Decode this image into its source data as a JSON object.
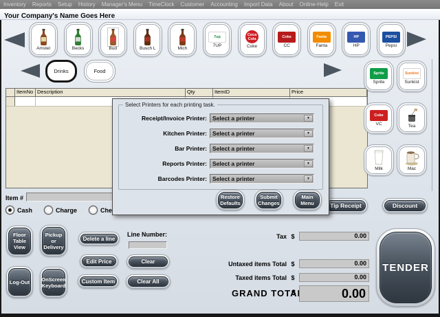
{
  "menu": {
    "items": [
      "Inventory",
      "Reports",
      "Setup",
      "History",
      "Manager's Menu",
      "TimeClock",
      "Customer",
      "Accounting",
      "Import Data",
      "About",
      "Online-Help",
      "Exit"
    ]
  },
  "header": {
    "company_name": "Your Company's Name Goes Here"
  },
  "products": {
    "top": [
      {
        "label": "Amstel",
        "icon": "bottle",
        "color": "#8a4a1f",
        "accent": "#e6d8a8"
      },
      {
        "label": "Becks",
        "icon": "bottle",
        "color": "#2e7d32",
        "accent": "#cfd8cf"
      },
      {
        "label": "Bud",
        "icon": "bottle",
        "color": "#9a5b2a",
        "accent": "#d8433f",
        "focus": true
      },
      {
        "label": "Busch L",
        "icon": "bottle",
        "color": "#5f2f10",
        "accent": "#a93226"
      },
      {
        "label": "Mich",
        "icon": "bottle",
        "color": "#7a3d18",
        "accent": "#c0392b"
      },
      {
        "label": "7UP",
        "icon": "logo",
        "bg": "#ffffff",
        "fg": "#15903c",
        "text": "7up"
      },
      {
        "label": "Coke",
        "icon": "logo",
        "bg": "#cf1f25",
        "fg": "#ffffff",
        "text": "Coca Cola",
        "round": true
      },
      {
        "label": "CC",
        "icon": "logo",
        "bg": "#b71c1c",
        "fg": "#ffffff",
        "text": "Coke"
      },
      {
        "label": "Fanta",
        "icon": "logo",
        "bg": "#f28c00",
        "fg": "#ffffff",
        "text": "Fanta"
      },
      {
        "label": "HP",
        "icon": "logo",
        "bg": "#3558b0",
        "fg": "#ffffff",
        "text": "HP"
      },
      {
        "label": "Pepsi",
        "icon": "logo",
        "bg": "#1b4fa0",
        "fg": "#ffffff",
        "text": "PEPSI"
      }
    ],
    "side": [
      {
        "label": "Sprite",
        "icon": "logo",
        "bg": "#0f9d46",
        "fg": "#ffffff",
        "text": "Sprite"
      },
      {
        "label": "Sunkist",
        "icon": "logo",
        "bg": "#ffffff",
        "fg": "#f07820",
        "text": "Sunkist"
      },
      {
        "label": "VC",
        "icon": "logo",
        "bg": "#cc1f1f",
        "fg": "#ffffff",
        "text": "Coke"
      },
      {
        "label": "Tea",
        "icon": "teabag"
      },
      {
        "label": "Milk",
        "icon": "glass"
      },
      {
        "label": "Mac",
        "icon": "mug"
      }
    ]
  },
  "categories": {
    "items": [
      {
        "label": "Drinks",
        "selected": true
      },
      {
        "label": "Food",
        "selected": false
      }
    ]
  },
  "order_table": {
    "columns": [
      "ItemNo",
      "Description",
      "Qty",
      "ItemID",
      "Price"
    ],
    "rows": []
  },
  "printer_dialog": {
    "title": "Select Printers for each printing task.",
    "fields": [
      {
        "label": "Receipt/Invoice Printer:",
        "value": "Select a printer"
      },
      {
        "label": "Kitchen Printer:",
        "value": "Select a printer"
      },
      {
        "label": "Bar Printer:",
        "value": "Select a printer"
      },
      {
        "label": "Reports Printer:",
        "value": "Select a printer"
      },
      {
        "label": "Barcodes Printer:",
        "value": "Select a printer"
      }
    ],
    "buttons": [
      {
        "label": "Restore\nDefaults"
      },
      {
        "label": "Submit\nChanges"
      },
      {
        "label": "Main\nMenu"
      }
    ]
  },
  "item_entry": {
    "label": "Item #",
    "value": ""
  },
  "payment_methods": [
    {
      "label": "Cash",
      "selected": true
    },
    {
      "label": "Charge",
      "selected": false
    },
    {
      "label": "Check",
      "selected": false
    }
  ],
  "line_number": {
    "label": "Line Number:",
    "value": ""
  },
  "actions": {
    "tip_receipt": "Tip Receipt",
    "discount": "Discount",
    "floor_table_view": "Floor\nTable\nView",
    "pickup_or_delivery": "Pickup\nor\nDelivery",
    "log_out": "Log-Out",
    "onscreen_keyboard": "OnScreen\nKeyboard",
    "delete_a_line": "Delete a line",
    "edit_price": "Edit Price",
    "custom_item": "Custom Item",
    "clear": "Clear",
    "clear_all": "Clear All",
    "tender": "TENDER"
  },
  "totals": {
    "rows": [
      {
        "label": "Tax",
        "currency": "$",
        "value": "0.00"
      },
      {
        "label": "Untaxed items Total",
        "currency": "$",
        "value": "0.00"
      },
      {
        "label": "Taxed items Total",
        "currency": "$",
        "value": "0.00"
      }
    ],
    "grand": {
      "label": "GRAND TOTAL",
      "currency": "$",
      "value": "0.00"
    }
  },
  "colors": {
    "menubar_bg": "#7d7d7d",
    "table_header_bg": "#eae6d2",
    "dialog_bg": "#dde3ea",
    "dark_button": "#3a424c",
    "sunken_field": "#c9c9c9",
    "arrow": "#4c5661"
  }
}
